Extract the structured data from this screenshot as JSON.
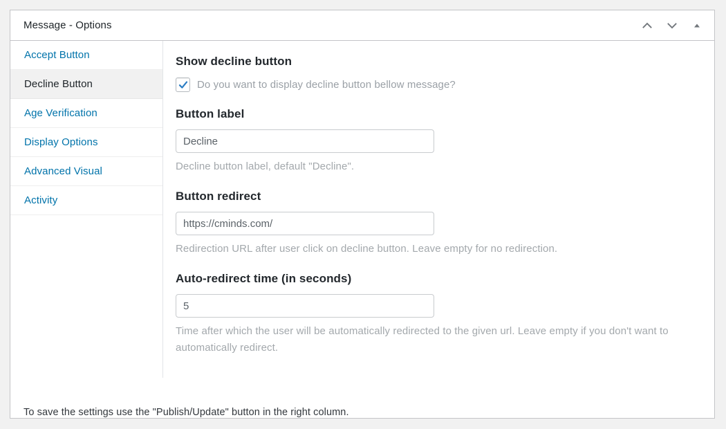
{
  "panel": {
    "title": "Message - Options",
    "actions": [
      {
        "name": "move-up-icon",
        "label": "Move up"
      },
      {
        "name": "move-down-icon",
        "label": "Move down"
      },
      {
        "name": "toggle-panel-icon",
        "label": "Toggle panel"
      }
    ]
  },
  "sidebar": {
    "items": [
      {
        "label": "Accept Button",
        "active": false
      },
      {
        "label": "Decline Button",
        "active": true
      },
      {
        "label": "Age Verification",
        "active": false
      },
      {
        "label": "Display Options",
        "active": false
      },
      {
        "label": "Advanced Visual",
        "active": false
      },
      {
        "label": "Activity",
        "active": false
      }
    ]
  },
  "content": {
    "show_decline": {
      "heading": "Show decline button",
      "checkbox_label": "Do you want to display decline button bellow message?",
      "checked": true
    },
    "button_label": {
      "heading": "Button label",
      "value": "Decline",
      "placeholder": "Decline",
      "description": "Decline button label, default \"Decline\"."
    },
    "button_redirect": {
      "heading": "Button redirect",
      "value": "https://cminds.com/",
      "placeholder": "https://cminds.com/",
      "description": "Redirection URL after user click on decline button. Leave empty for no redirection."
    },
    "auto_redirect": {
      "heading": "Auto-redirect time (in seconds)",
      "value": "5",
      "placeholder": "5",
      "description": "Time after which the user will be automatically redirected to the given url. Leave empty if you don't want to automatically redirect."
    }
  },
  "footer": {
    "note": "To save the settings use the \"Publish/Update\" button in the right column."
  },
  "colors": {
    "link": "#0073aa",
    "accent_check": "#2b7dc4",
    "heading": "#23282d",
    "muted": "#a3a8ac",
    "panel_border": "#c3c4c7",
    "active_bg": "#f1f1f1"
  }
}
